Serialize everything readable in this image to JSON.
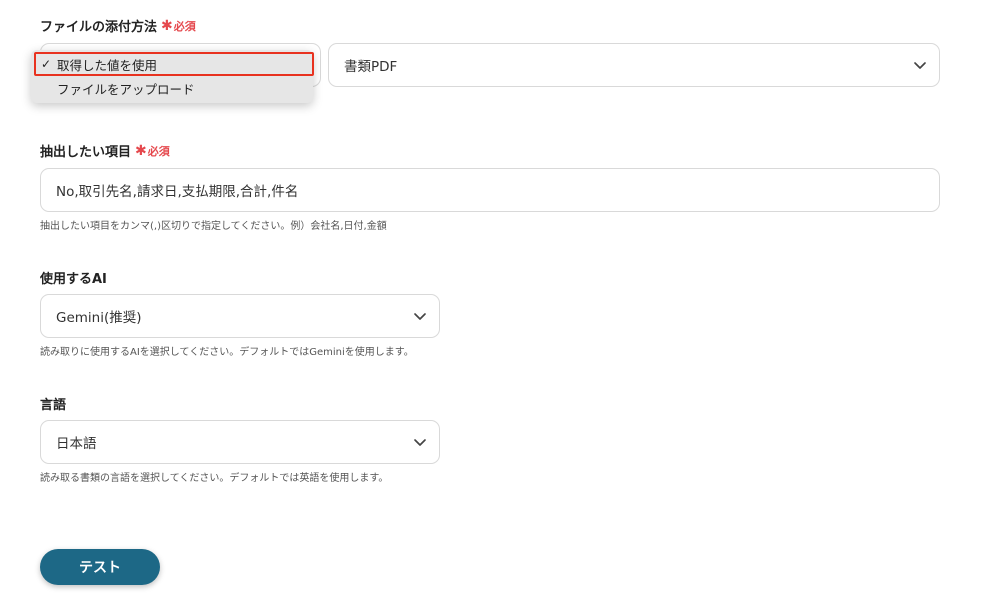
{
  "attachment": {
    "label": "ファイルの添付方法",
    "required": "必須",
    "select_value": "書類PDF",
    "menu_items": [
      {
        "label": "取得した値を使用",
        "checked": true
      },
      {
        "label": "ファイルをアップロード",
        "checked": false
      }
    ],
    "check_glyph": "✓"
  },
  "extract": {
    "label": "抽出したい項目",
    "required": "必須",
    "value": "No,取引先名,請求日,支払期限,合計,件名",
    "help": "抽出したい項目をカンマ(,)区切りで指定してください。例）会社名,日付,金額"
  },
  "ai": {
    "label": "使用するAI",
    "value": "Gemini(推奨)",
    "help": "読み取りに使用するAIを選択してください。デフォルトではGeminiを使用します。"
  },
  "language": {
    "label": "言語",
    "value": "日本語",
    "help": "読み取る書類の言語を選択してください。デフォルトでは英語を使用します。"
  },
  "test_button": "テスト",
  "colors": {
    "accent": "#1d6886",
    "required": "#e5484d",
    "highlight": "#e8321f"
  },
  "icons": {
    "chevron": "chevron-down-icon",
    "required_star": "asterisk-icon"
  }
}
